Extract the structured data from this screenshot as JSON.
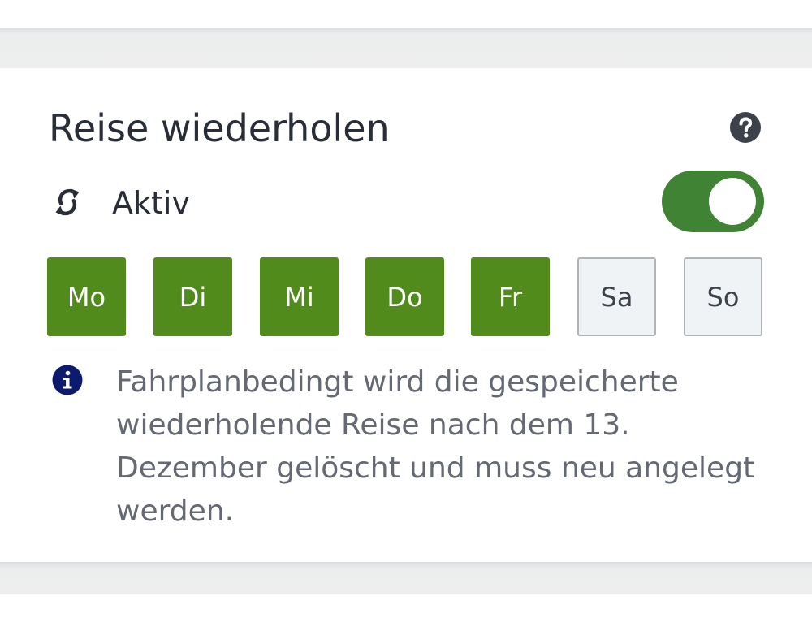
{
  "section": {
    "title": "Reise wiederholen",
    "help_icon": "help-circle-icon"
  },
  "repeat": {
    "icon": "repeat-icon",
    "label": "Aktiv",
    "toggle_on": true,
    "toggle_color": "#408335"
  },
  "weekdays": [
    {
      "label": "Mo",
      "selected": true
    },
    {
      "label": "Di",
      "selected": true
    },
    {
      "label": "Mi",
      "selected": true
    },
    {
      "label": "Do",
      "selected": true
    },
    {
      "label": "Fr",
      "selected": true
    },
    {
      "label": "Sa",
      "selected": false
    },
    {
      "label": "So",
      "selected": false
    }
  ],
  "colors": {
    "selected_day": "#508b1b",
    "info_icon": "#0c1b6e"
  },
  "notice": {
    "icon": "info-icon",
    "text": "Fahrplanbedingt wird die gespeicherte wiederholende Reise nach dem 13. Dezember gelöscht und muss neu angelegt werden."
  }
}
